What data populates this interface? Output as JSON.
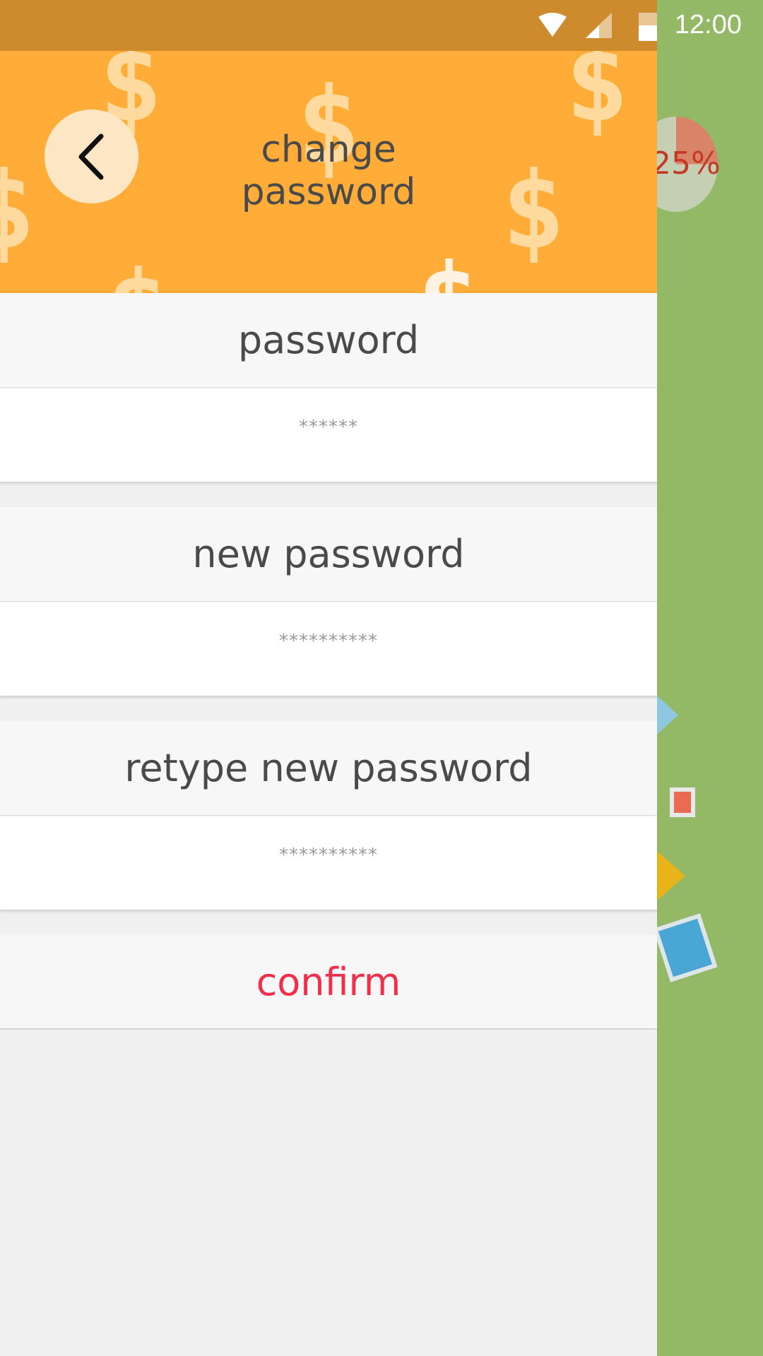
{
  "status_bar": {
    "time": "12:00"
  },
  "background": {
    "pie_label": "25%"
  },
  "header": {
    "title_line1": "change",
    "title_line2": "password",
    "back_icon": "chevron-left-icon"
  },
  "fields": {
    "password": {
      "label": "password",
      "placeholder": "******"
    },
    "new_password": {
      "label": "new password",
      "placeholder": "**********"
    },
    "retype_password": {
      "label": "retype new password",
      "placeholder": "**********"
    }
  },
  "confirm": {
    "label": "confirm"
  },
  "colors": {
    "header_bg": "#ffad38",
    "status_bar_bg": "#cd8b2d",
    "background_green": "#94b966",
    "confirm_text": "#f0304a",
    "label_text": "#4a4a4a"
  }
}
